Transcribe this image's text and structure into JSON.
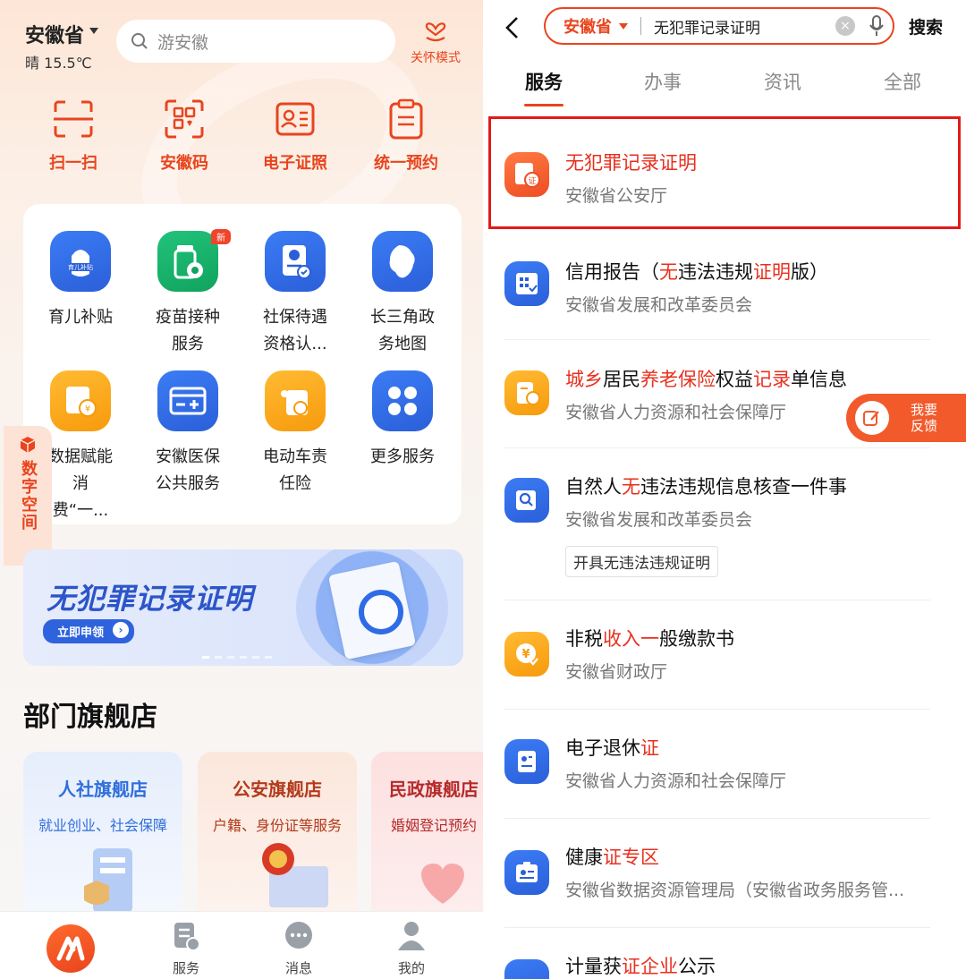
{
  "left": {
    "location": "安徽省",
    "weather": "晴 15.5℃",
    "search_placeholder": "游安徽",
    "care_label": "关怀模式",
    "quick": [
      "扫一扫",
      "安徽码",
      "电子证照",
      "统一预约"
    ],
    "services": [
      {
        "label": "育儿补贴",
        "icon": "baby-subsidy-icon",
        "color": "blue",
        "icon_text": "育儿补贴"
      },
      {
        "label": "疫苗接种服务",
        "icon": "vaccine-icon",
        "color": "green",
        "badge": "新"
      },
      {
        "label": "社保待遇资格认...",
        "icon": "social-security-icon",
        "color": "blue"
      },
      {
        "label": "长三角政务地图",
        "icon": "map-icon",
        "color": "blue"
      },
      {
        "label": "数据赋能消费“一...",
        "icon": "data-consumption-icon",
        "color": "orange"
      },
      {
        "label": "安徽医保公共服务",
        "icon": "medical-card-icon",
        "color": "blue"
      },
      {
        "label": "电动车责任险",
        "icon": "ebike-insurance-icon",
        "color": "orange"
      },
      {
        "label": "更多服务",
        "icon": "more-grid-icon",
        "color": "blue"
      }
    ],
    "digital_space": "数字空间",
    "banner": {
      "title": "无犯罪记录证明",
      "button": "立即申领"
    },
    "dept_title": "部门旗舰店",
    "stores": [
      {
        "name": "人社旗舰店",
        "desc": "就业创业、社会保障",
        "color": "#2f6fdc",
        "bg": "#e6eefc"
      },
      {
        "name": "公安旗舰店",
        "desc": "户籍、身份证等服务",
        "color": "#b33a1c",
        "bg": "#fbe7dc"
      },
      {
        "name": "民政旗舰店",
        "desc": "婚姻登记预约",
        "color": "#b52a2a",
        "bg": "#fde0e0"
      }
    ],
    "tabbar": [
      "服务",
      "消息",
      "我的"
    ]
  },
  "right": {
    "province": "安徽省",
    "query": "无犯罪记录证明",
    "search_btn": "搜索",
    "tabs": [
      "服务",
      "办事",
      "资讯",
      "全部"
    ],
    "feedback": [
      "我要",
      "反馈"
    ],
    "results": [
      {
        "title_parts": [
          {
            "t": "无犯罪记录证明",
            "h": true
          }
        ],
        "dept": "安徽省公安厅",
        "color": "#f3602e"
      },
      {
        "title_parts": [
          {
            "t": "信用报告（",
            "h": false
          },
          {
            "t": "无",
            "h": true
          },
          {
            "t": "违法违规",
            "h": false
          },
          {
            "t": "证明",
            "h": true
          },
          {
            "t": "版）",
            "h": false
          }
        ],
        "dept": "安徽省发展和改革委员会",
        "color": "#2f63de"
      },
      {
        "title_parts": [
          {
            "t": "城乡",
            "h": true
          },
          {
            "t": "居民",
            "h": false
          },
          {
            "t": "养老保险",
            "h": true
          },
          {
            "t": "权益",
            "h": false
          },
          {
            "t": "记录",
            "h": true
          },
          {
            "t": "单信息",
            "h": false
          }
        ],
        "dept": "安徽省人力资源和社会保障厅",
        "color": "#f6a823"
      },
      {
        "title_parts": [
          {
            "t": "自然人",
            "h": false
          },
          {
            "t": "无",
            "h": true
          },
          {
            "t": "违法违规信息核查一件事",
            "h": false
          }
        ],
        "dept": "安徽省发展和改革委员会",
        "tag": "开具无违法违规证明",
        "color": "#2f63de"
      },
      {
        "title_parts": [
          {
            "t": "非税",
            "h": false
          },
          {
            "t": "收入一",
            "h": true
          },
          {
            "t": "般缴款书",
            "h": false
          }
        ],
        "dept": "安徽省财政厅",
        "color": "#f6a823"
      },
      {
        "title_parts": [
          {
            "t": "电子退休",
            "h": false
          },
          {
            "t": "证",
            "h": true
          }
        ],
        "dept": "安徽省人力资源和社会保障厅",
        "color": "#2f63de"
      },
      {
        "title_parts": [
          {
            "t": "健康",
            "h": false
          },
          {
            "t": "证专区",
            "h": true
          }
        ],
        "dept": "安徽省数据资源管理局（安徽省政务服务管...",
        "color": "#2f63de"
      },
      {
        "title_parts": [
          {
            "t": "计量获",
            "h": false
          },
          {
            "t": "证企业",
            "h": true
          },
          {
            "t": "公示",
            "h": false
          }
        ],
        "dept": "",
        "color": "#2f63de"
      }
    ]
  }
}
